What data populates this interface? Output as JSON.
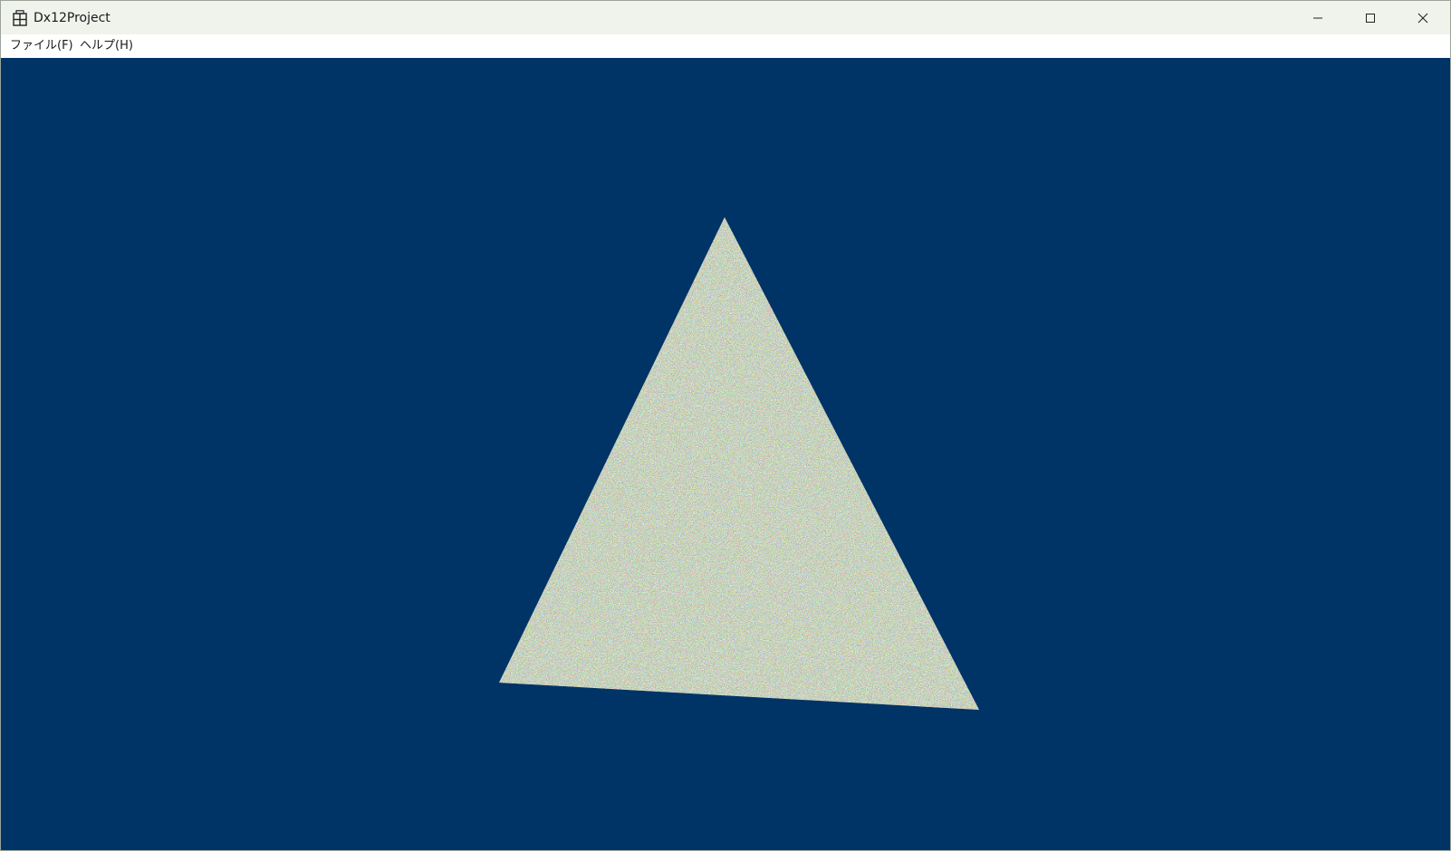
{
  "window": {
    "title": "Dx12Project",
    "icons": {
      "app": "app-grid-icon",
      "minimize": "minimize-icon",
      "maximize": "maximize-icon",
      "close": "close-icon"
    }
  },
  "menu": {
    "items": [
      {
        "label": "ファイル(F)"
      },
      {
        "label": "ヘルプ(H)"
      }
    ]
  },
  "viewport": {
    "clear_color": "#003366",
    "shape": "triangle",
    "fill": "random-noise-texture"
  }
}
